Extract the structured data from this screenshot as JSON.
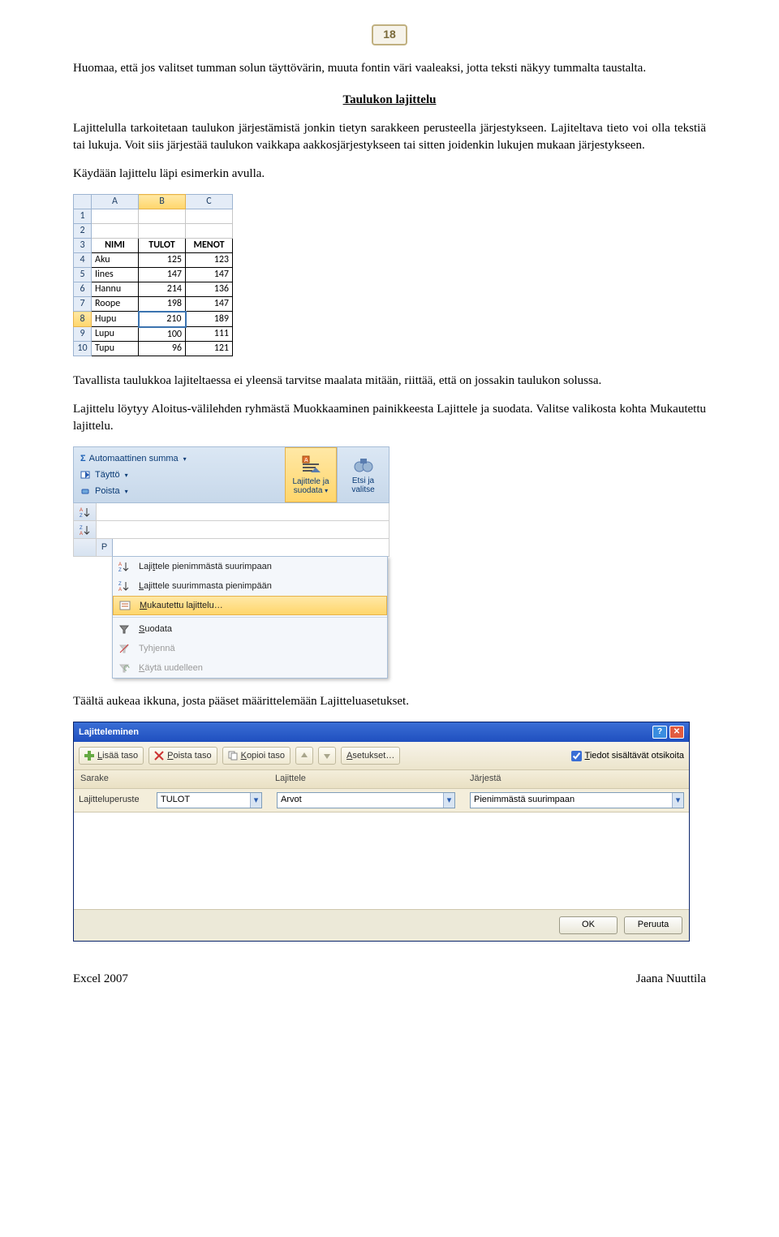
{
  "page_number": "18",
  "para1": "Huomaa, että jos valitset tumman solun täyttövärin, muuta fontin väri vaaleaksi, jotta teksti näkyy tummalta taustalta.",
  "section_heading": "Taulukon lajittelu",
  "para2": "Lajittelulla tarkoitetaan taulukon järjestämistä jonkin tietyn sarakkeen perusteella järjestykseen. Lajiteltava tieto voi olla tekstiä tai lukuja. Voit siis järjestää taulukon vaikkapa aakkosjärjestykseen tai sitten joidenkin lukujen mukaan järjestykseen.",
  "para3": "Käydään lajittelu läpi esimerkin avulla.",
  "sheet1": {
    "cols": [
      "A",
      "B",
      "C"
    ],
    "rows": [
      "1",
      "2",
      "3",
      "4",
      "5",
      "6",
      "7",
      "8",
      "9",
      "10"
    ],
    "headers": [
      "NIMI",
      "TULOT",
      "MENOT"
    ],
    "data": [
      [
        "Aku",
        "125",
        "123"
      ],
      [
        "Iines",
        "147",
        "147"
      ],
      [
        "Hannu",
        "214",
        "136"
      ],
      [
        "Roope",
        "198",
        "147"
      ],
      [
        "Hupu",
        "210",
        "189"
      ],
      [
        "Lupu",
        "100",
        "111"
      ],
      [
        "Tupu",
        "96",
        "121"
      ]
    ],
    "selected_row": "8",
    "selected_col": "B"
  },
  "para4": "Tavallista taulukkoa lajiteltaessa ei yleensä tarvitse maalata mitään, riittää, että on jossakin taulukon solussa.",
  "para5": "Lajittelu löytyy Aloitus-välilehden ryhmästä Muokkaaminen painikkeesta Lajittele ja suodata. Valitse valikosta kohta Mukautettu lajittelu.",
  "ribbon": {
    "left": {
      "autosum": "Automaattinen summa",
      "fill": "Täyttö",
      "clear": "Poista"
    },
    "big": {
      "sort": {
        "line1": "Lajittele ja",
        "line2": "suodata"
      },
      "find": {
        "line1": "Etsi ja",
        "line2": "valitse"
      }
    },
    "row_letter": "P",
    "menu": {
      "asc": "Lajittele pienimmästä suurimpaan",
      "desc": "Lajittele suurimmasta pienimpään",
      "custom": "Mukautettu lajittelu…",
      "filter": "Suodata",
      "clear": "Tyhjennä",
      "reapply": "Käytä uudelleen"
    }
  },
  "para6": "Täältä aukeaa ikkuna, josta pääset määrittelemään Lajitteluasetukset.",
  "dialog": {
    "title": "Lajitteleminen",
    "add": "Lisää taso",
    "remove": "Poista taso",
    "copy": "Kopioi taso",
    "options": "Asetukset…",
    "has_headers": "Tiedot sisältävät otsikoita",
    "headers_checked": true,
    "col_h": {
      "sarake": "Sarake",
      "lajit": "Lajittele",
      "jarjesta": "Järjestä"
    },
    "row": {
      "label": "Lajitteluperuste",
      "sarake_val": "TULOT",
      "lajit_val": "Arvot",
      "jarjesta_val": "Pienimmästä suurimpaan"
    },
    "ok": "OK",
    "cancel": "Peruuta"
  },
  "footer": {
    "left": "Excel 2007",
    "right": "Jaana Nuuttila"
  }
}
